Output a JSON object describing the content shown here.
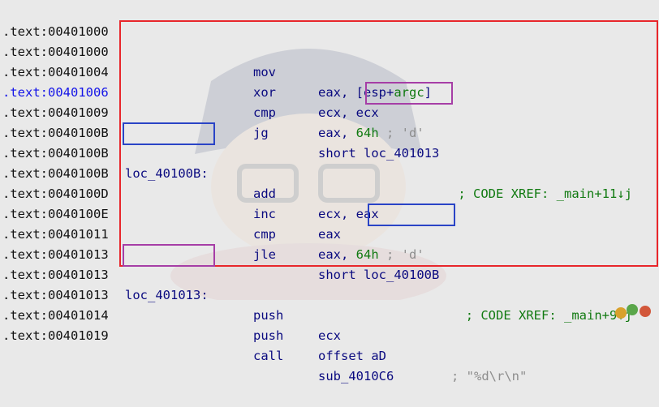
{
  "colors": {
    "background": "#e9e9e9",
    "address": "#111111",
    "current_address": "#1515e8",
    "code": "#0a0a80",
    "number": "#117a11",
    "comment": "#8d8d8d",
    "highlight_red": "#e8262b",
    "highlight_blue": "#2a44c6",
    "highlight_purple": "#a63ea6"
  },
  "lines": [
    {
      "addr": ".text:00401000"
    },
    {
      "addr": ".text:00401000",
      "mnemonic": "mov",
      "operands": "eax, [esp+",
      "operand_arg": "argc",
      "operand_tail": "]"
    },
    {
      "addr": ".text:00401004",
      "mnemonic": "xor",
      "operands": "ecx, ecx"
    },
    {
      "addr": ".text:00401006",
      "current": true,
      "mnemonic": "cmp",
      "operands": "eax, ",
      "operand_num": "64h",
      "comment": " ; 'd'"
    },
    {
      "addr": ".text:00401009",
      "mnemonic": "jg",
      "operands": "short ",
      "operand_label": "loc_401013"
    },
    {
      "addr": ".text:0040100B"
    },
    {
      "addr": ".text:0040100B",
      "label": "loc_40100B:",
      "xref": "; CODE XREF: _main+11↓j"
    },
    {
      "addr": ".text:0040100B",
      "mnemonic": "add",
      "operands": "ecx, eax"
    },
    {
      "addr": ".text:0040100D",
      "mnemonic": "inc",
      "operands": "eax"
    },
    {
      "addr": ".text:0040100E",
      "mnemonic": "cmp",
      "operands": "eax, ",
      "operand_num": "64h",
      "comment": " ; 'd'"
    },
    {
      "addr": ".text:00401011",
      "mnemonic": "jle",
      "operands": "short ",
      "operand_label": "loc_40100B"
    },
    {
      "addr": ".text:00401013"
    },
    {
      "addr": ".text:00401013",
      "label": "loc_401013:",
      "xref": "; CODE XREF: _main+9↑j"
    },
    {
      "addr": ".text:00401013",
      "mnemonic": "push",
      "operands": "ecx"
    },
    {
      "addr": ".text:00401014",
      "mnemonic": "push",
      "operands": "offset aD",
      "right_comment": "; \"%d\\r\\n\""
    },
    {
      "addr": ".text:00401019",
      "mnemonic": "call",
      "operands": "sub_4010C6"
    }
  ]
}
